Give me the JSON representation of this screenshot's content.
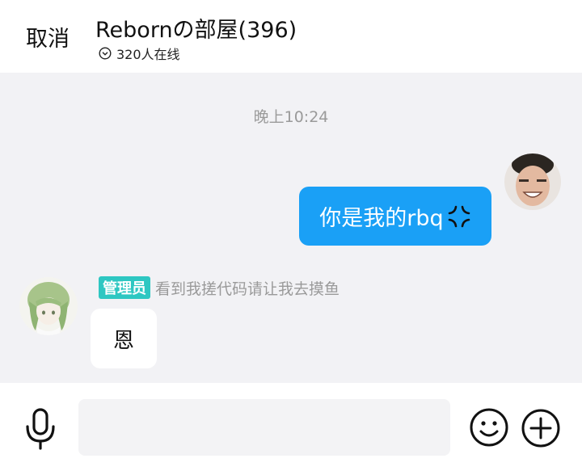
{
  "header": {
    "cancel_label": "取消",
    "room_title": "Rebornの部屋(396)",
    "online_text": "320人在线"
  },
  "chat": {
    "timestamp": "晚上10:24",
    "messages": [
      {
        "from": "me",
        "text": "你是我的rbq",
        "emoji": "anger-icon"
      },
      {
        "from": "other",
        "role_badge": "管理员",
        "member_title": "看到我搓代码请让我去摸鱼",
        "text": "恩"
      }
    ]
  },
  "input_bar": {
    "placeholder": "",
    "icons": [
      "microphone-icon",
      "smiley-icon",
      "plus-icon"
    ]
  },
  "colors": {
    "bubble_me": "#1aa0f6",
    "admin_badge": "#2ec7c2",
    "chat_background": "#f2f2f5"
  }
}
